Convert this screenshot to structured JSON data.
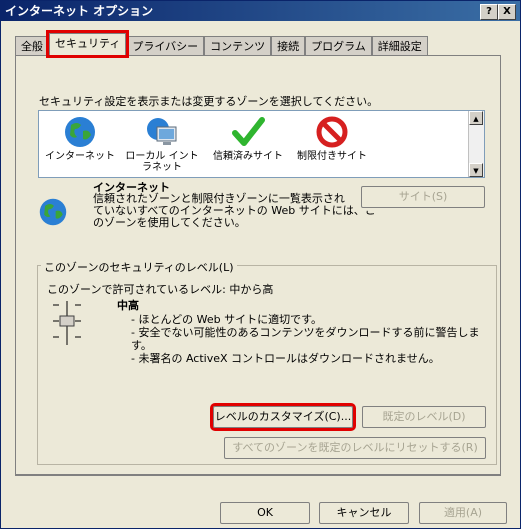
{
  "window": {
    "title": "インターネット オプション",
    "help_btn": "?",
    "close_btn": "X"
  },
  "tabs": [
    {
      "label": "全般",
      "active": false
    },
    {
      "label": "セキュリティ",
      "active": true,
      "highlighted": true
    },
    {
      "label": "プライバシー",
      "active": false
    },
    {
      "label": "コンテンツ",
      "active": false
    },
    {
      "label": "接続",
      "active": false
    },
    {
      "label": "プログラム",
      "active": false
    },
    {
      "label": "詳細設定",
      "active": false
    }
  ],
  "security": {
    "instruction": "セキュリティ設定を表示または変更するゾーンを選択してください。",
    "zones": [
      {
        "label": "インターネット",
        "icon": "globe-icon"
      },
      {
        "label": "ローカル イントラネット",
        "label_line1": "ローカル イント",
        "label_line2": "ラネット",
        "icon": "intranet-monitor-icon"
      },
      {
        "label": "信頼済みサイト",
        "icon": "checkmark-icon"
      },
      {
        "label": "制限付きサイト",
        "icon": "restricted-icon"
      }
    ],
    "selected_zone": {
      "name": "インターネット",
      "description_line1": "信頼されたゾーンと制限付きゾーンに一覧表示され",
      "description_line2": "ていないすべてのインターネットの Web サイトには、こ",
      "description_line3": "のゾーンを使用してください。"
    },
    "sites_button": "サイト(S)",
    "level_group": {
      "title": "このゾーンのセキュリティのレベル(L)",
      "allowed": "このゾーンで許可されているレベル: 中から高",
      "level_name": "中高",
      "bullet1": "- ほとんどの Web サイトに適切です。",
      "bullet2_line1": "- 安全でない可能性のあるコンテンツをダウンロードする前に警告しま",
      "bullet2_line2": "す。",
      "bullet3": "- 未署名の ActiveX コントロールはダウンロードされません。"
    },
    "customize_button": "レベルのカスタマイズ(C)...",
    "default_level_button": "既定のレベル(D)",
    "reset_all_button": "すべてのゾーンを既定のレベルにリセットする(R)"
  },
  "footer": {
    "ok": "OK",
    "cancel": "キャンセル",
    "apply": "適用(A)"
  },
  "colors": {
    "highlight": "#e00000",
    "title_bar": "#0a246a"
  }
}
